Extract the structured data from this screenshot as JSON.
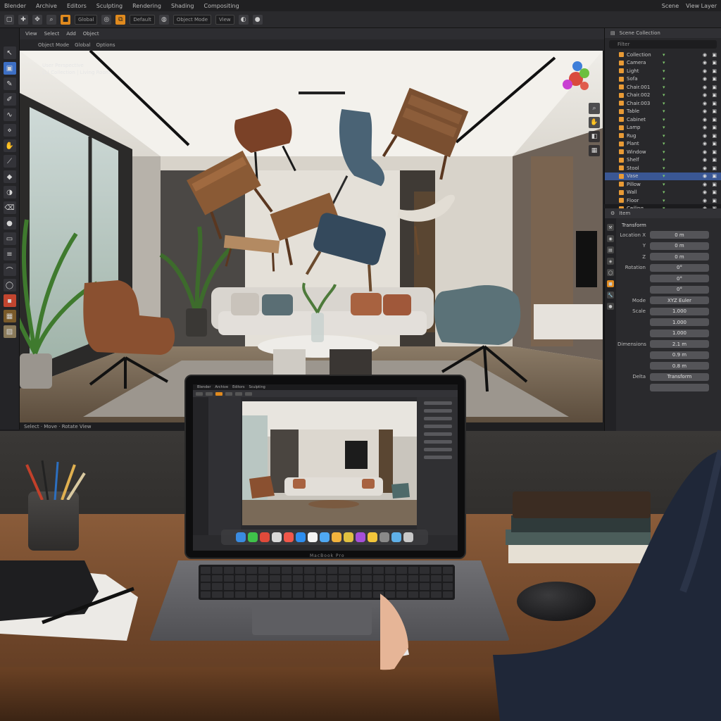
{
  "app": {
    "menu": [
      "Blender",
      "Archive",
      "Editors",
      "Sculpting",
      "Rendering",
      "Shading",
      "Compositing"
    ],
    "menu_right": [
      "Scene",
      "View Layer"
    ],
    "toolbar_fields": [
      "Global",
      "Default",
      "Object Mode",
      "View"
    ]
  },
  "viewport": {
    "header_items": [
      "View",
      "Select",
      "Add",
      "Object"
    ],
    "header2_items": [
      "Object Mode",
      "Global",
      "Options"
    ],
    "info_line1": "User Perspective",
    "info_line2": "(1) Collection | Living Room",
    "footer": "Select · Move · Rotate View"
  },
  "outliner": {
    "title": "Scene Collection",
    "search_placeholder": "Filter",
    "rows": [
      "Collection",
      "Camera",
      "Light",
      "Sofa",
      "Chair.001",
      "Chair.002",
      "Chair.003",
      "Table",
      "Cabinet",
      "Lamp",
      "Rug",
      "Plant",
      "Window",
      "Shelf",
      "Stool",
      "Vase",
      "Pillow",
      "Wall",
      "Floor",
      "Ceiling"
    ],
    "selected_index": 15
  },
  "properties": {
    "title": "Item",
    "section": "Transform",
    "rows": [
      {
        "label": "Location X",
        "value": "0 m"
      },
      {
        "label": "Y",
        "value": "0 m"
      },
      {
        "label": "Z",
        "value": "0 m"
      },
      {
        "label": "Rotation",
        "value": "0°"
      },
      {
        "label": "",
        "value": "0°"
      },
      {
        "label": "",
        "value": "0°"
      },
      {
        "label": "Mode",
        "value": "XYZ Euler"
      },
      {
        "label": "Scale",
        "value": "1.000"
      },
      {
        "label": "",
        "value": "1.000"
      },
      {
        "label": "",
        "value": "1.000"
      },
      {
        "label": "Dimensions",
        "value": "2.1 m"
      },
      {
        "label": "",
        "value": "0.9 m"
      },
      {
        "label": "",
        "value": "0.8 m"
      },
      {
        "label": "Delta",
        "value": "Transform"
      },
      {
        "label": "",
        "value": ""
      }
    ]
  },
  "laptop": {
    "brand": "MacBook Pro"
  },
  "colors": {
    "accent": "#3d6fc4",
    "orange": "#e08a1e",
    "panel": "#2a2a2d"
  }
}
